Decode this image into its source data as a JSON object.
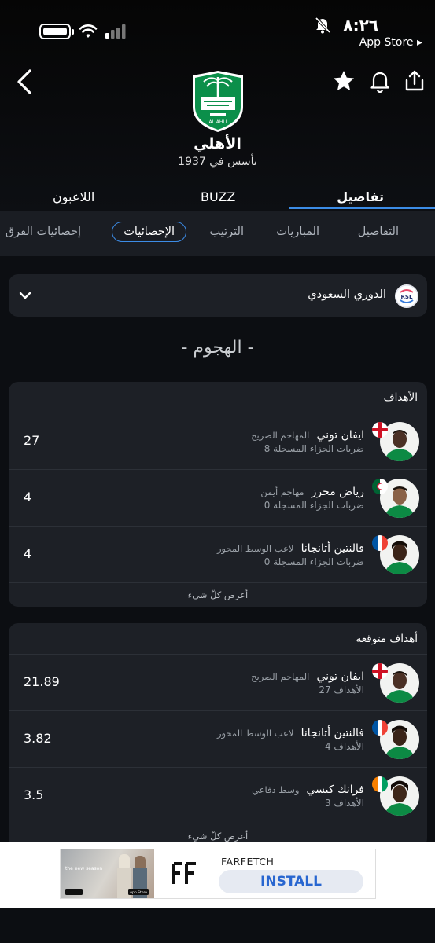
{
  "status_bar": {
    "time": "٨:٢٦",
    "back_to_app": "App Store ▸"
  },
  "club": {
    "name": "الأهلي",
    "founded": "تأسس في 1937",
    "logo_text": "AL AHLI"
  },
  "main_tabs": [
    {
      "label": "تفاصيل",
      "active": true
    },
    {
      "label": "BUZZ",
      "active": false
    },
    {
      "label": "اللاعبون",
      "active": false
    }
  ],
  "sub_tabs": [
    {
      "label": "التفاصيل",
      "active": false
    },
    {
      "label": "المباريات",
      "active": false
    },
    {
      "label": "الترتيب",
      "active": false
    },
    {
      "label": "الإحصائيات",
      "active": true
    },
    {
      "label": "إحصائيات الفرق",
      "active": false
    }
  ],
  "league": {
    "name": "الدوري السعودي",
    "logo_text": "RSL"
  },
  "section_title": "- الهجوم -",
  "goals_card": {
    "title": "الأهداف",
    "see_all": "أعرض كلّ شيء",
    "rows": [
      {
        "name": "ايفان توني",
        "position": "المهاجم الصريح",
        "sub": "ضربات الجزاء المسجلة 8",
        "value": "27",
        "flag": "england"
      },
      {
        "name": "رياض محرز",
        "position": "مهاجم أيمن",
        "sub": "ضربات الجزاء المسجلة 0",
        "value": "4",
        "flag": "algeria"
      },
      {
        "name": "فالنتين أتانجانا",
        "position": "لاعب الوسط المحور",
        "sub": "ضربات الجزاء المسجلة 0",
        "value": "4",
        "flag": "france"
      }
    ]
  },
  "xg_card": {
    "title": "أهداف متوقعة",
    "see_all": "أعرض كلّ شيء",
    "rows": [
      {
        "name": "ايفان توني",
        "position": "المهاجم الصريح",
        "sub": "الأهداف 27",
        "value": "21.89",
        "flag": "england"
      },
      {
        "name": "فالنتين أتانجانا",
        "position": "لاعب الوسط المحور",
        "sub": "الأهداف 4",
        "value": "3.82",
        "flag": "france"
      },
      {
        "name": "فرانك كيسي",
        "position": "وسط دفاعي",
        "sub": "الأهداف 3",
        "value": "3.5",
        "flag": "ivory-coast"
      }
    ]
  },
  "ad": {
    "brand": "FARFETCH",
    "cta": "INSTALL",
    "photo_text": "the new season",
    "store_badge": "App Store"
  },
  "colors": {
    "accent": "#3c8ce6",
    "background": "#0c0e12",
    "card": "#1d2026",
    "club_green": "#0b8f4a"
  }
}
